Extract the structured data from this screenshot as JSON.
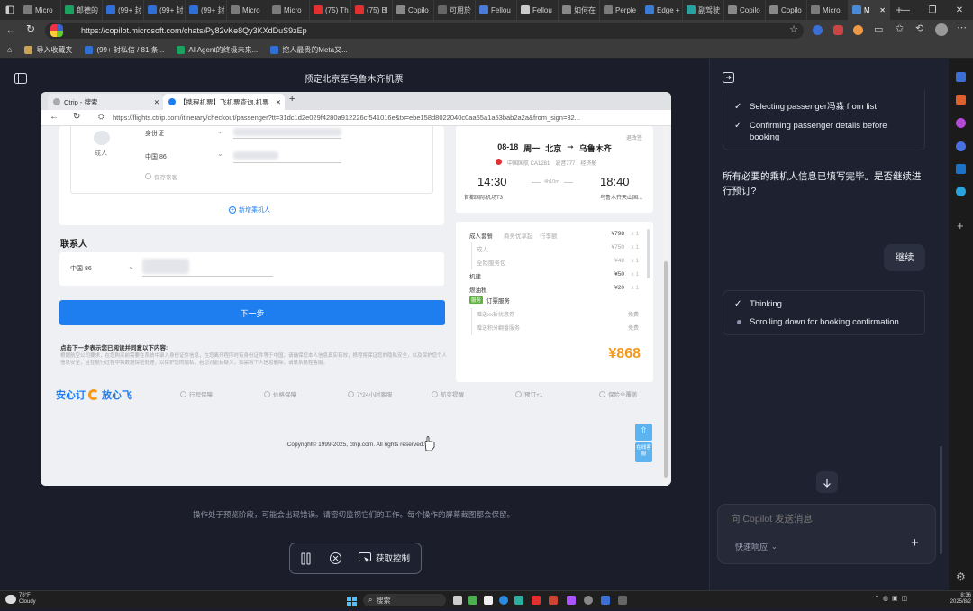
{
  "browser": {
    "tabs": [
      {
        "label": "Micro",
        "color": "#7b7b7b"
      },
      {
        "label": "郎德的",
        "color": "#1aa260"
      },
      {
        "label": "(99+ 封",
        "color": "#2f6fd6"
      },
      {
        "label": "(99+ 封",
        "color": "#2f6fd6"
      },
      {
        "label": "(99+ 封",
        "color": "#2f6fd6"
      },
      {
        "label": "Micro",
        "color": "#7b7b7b"
      },
      {
        "label": "Micro",
        "color": "#7b7b7b"
      },
      {
        "label": "(75) Th",
        "color": "#e23030"
      },
      {
        "label": "(75) Bl",
        "color": "#e23030"
      },
      {
        "label": "Copilo",
        "color": "#888"
      },
      {
        "label": "可用於",
        "color": "#666"
      },
      {
        "label": "Fellou",
        "color": "#4a7bd6"
      },
      {
        "label": "Fellou",
        "color": "#cccccc"
      },
      {
        "label": "如何在",
        "color": "#888"
      },
      {
        "label": "Perple",
        "color": "#7b7b7b"
      },
      {
        "label": "Edge +",
        "color": "#3a7bd5"
      },
      {
        "label": "副驾驶",
        "color": "#2aa0a0"
      },
      {
        "label": "Copilo",
        "color": "#888"
      },
      {
        "label": "Copilo",
        "color": "#888"
      },
      {
        "label": "Micro",
        "color": "#7b7b7b"
      },
      {
        "label": "M",
        "color": "#4a8bd6"
      }
    ],
    "url": "https://copilot.microsoft.com/chats/Py82vKe8Qy3KXdDuS9zEp",
    "favorites": [
      {
        "label": "导入收藏夹",
        "color": "#c9a35a"
      },
      {
        "label": "(99+ 封私信 / 81 条...",
        "color": "#2f6fd6"
      },
      {
        "label": "AI Agent的终极未来...",
        "color": "#1aa260"
      },
      {
        "label": "挖人最贵的Meta又...",
        "color": "#2f6fd6"
      }
    ]
  },
  "left": {
    "title": "预定北京至乌鲁木齐机票",
    "notice": "操作处于预览阶段，可能会出现错误。请密切监视它们的工作。每个操作的屏幕截图都会保留。",
    "controls": {
      "take_control": "获取控制"
    }
  },
  "inner": {
    "tabs": [
      {
        "label": "Ctrip - 搜索"
      },
      {
        "label": "【携程机票】飞机票查询,机票"
      }
    ],
    "url": "https://flights.ctrip.com/itinerary/checkout/passenger?tt=31dc1d2e029f4280a912226cf541016e&tx=ebe158d8022040c0aa55a1a53bab2a2a&from_sign=32...",
    "passenger": {
      "id_label": "身份证",
      "adult": "成人",
      "country": "中国 86",
      "save_label": "保存常客",
      "add_label": "新增乘机人"
    },
    "contact": {
      "title": "联系人",
      "country": "中国 86"
    },
    "next_button": "下一步",
    "terms_title": "点击下一步表示您已阅读并同意以下内容:",
    "terms_text": "根据航空公司要求，在您购买前需要在系统中录入身份证件信息，在您离开程序时有身份证件等于中国，请确保您本人信息真实有效，携程将保证您的隐私安全，以及保护您个人信息安全，且在航行过程中将数据保密处理，以保护您的隐私，若您对此有疑义，如需将个人信息删除，请联系携程客服。",
    "brand_left": "安心订",
    "brand_right": "放心飞",
    "features": [
      "行程保障",
      "价格保障",
      "7*24小时客服",
      "航变提醒",
      "预订+1",
      "保险全覆盖"
    ],
    "copyright": "Copyright© 1999-2025, ctrip.com. All rights reserved.",
    "flight": {
      "date": "08-18",
      "weekday": "周一",
      "from": "北京",
      "to": "乌鲁木齐",
      "arrow": "➞",
      "airline": "中国国航 CA1281",
      "aircraft": "波音777",
      "econ": "经济舱",
      "refund": "退改签",
      "dep_time": "14:30",
      "arr_time": "18:40",
      "duration": "4h10m",
      "dep_airport": "首都国际机场T3",
      "arr_airport": "乌鲁木齐天山国..."
    },
    "price": {
      "rows": [
        {
          "label": "成人套餐",
          "extra": "商务优享起",
          "extra2": "行李额",
          "value": "¥798",
          "qty": "x 1"
        },
        {
          "label": "成人",
          "value": "¥750",
          "qty": "x 1",
          "sub": true
        },
        {
          "label": "全险服务包",
          "value": "¥48",
          "qty": "x 1",
          "sub": true
        },
        {
          "label": "机建",
          "value": "¥50",
          "qty": "x 1"
        },
        {
          "label": "燃油税",
          "value": "¥20",
          "qty": "x 1"
        }
      ],
      "service": "订票服务",
      "service_rows": [
        {
          "label": "赠送xx折优惠券",
          "value": "免费"
        },
        {
          "label": "赠送积分翻番服务",
          "value": "免费"
        }
      ],
      "total": "¥868"
    },
    "float_btn": "在线客服"
  },
  "right": {
    "steps_top": [
      "Selecting passenger冯淼 from list",
      "Confirming passenger details before booking"
    ],
    "assistant_msg": "所有必要的乘机人信息已填写完毕。是否继续进行预订?",
    "user_msg": "继续",
    "steps_bottom": [
      {
        "label": "Thinking",
        "status": "done"
      },
      {
        "label": "Scrolling down for booking confirmation",
        "status": "active"
      }
    ],
    "input_placeholder": "向 Copilot 发送消息",
    "quick_reply": "快速响应"
  },
  "taskbar": {
    "weather": "Cloudy",
    "temp": "78°F",
    "search": "搜索",
    "time": "8:36",
    "date": "2025/8/2"
  }
}
